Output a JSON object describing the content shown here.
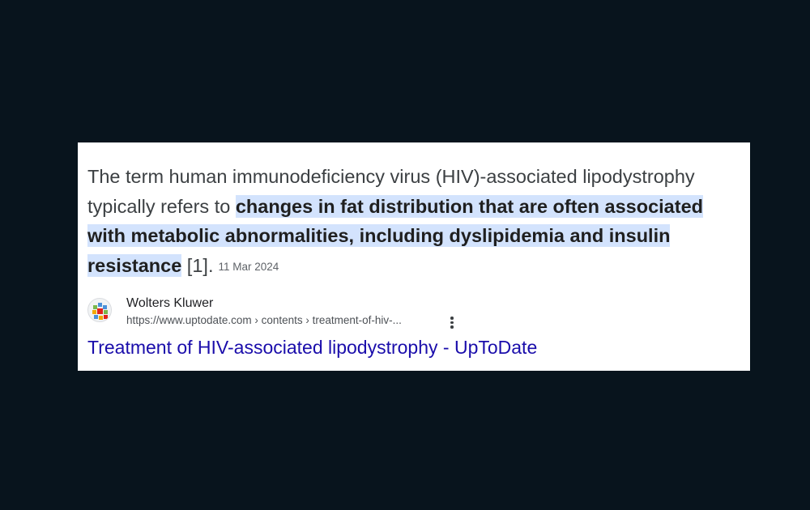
{
  "snippet": {
    "prefix": "The term human immunodeficiency virus (HIV)-associated lipodystrophy typically refers to ",
    "highlight": "changes in fat distribution that are often associated with metabolic abnormalities, including dyslipidemia and insulin resistance",
    "citation": " [1].",
    "date": "11 Mar 2024"
  },
  "result": {
    "site_name": "Wolters Kluwer",
    "url_breadcrumb": "https://www.uptodate.com › contents › treatment-of-hiv-...",
    "favicon_icon": "wolters-kluwer-logo-icon",
    "more_options_icon": "more-vert-icon",
    "title": "Treatment of HIV-associated lipodystrophy - UpToDate"
  },
  "colors": {
    "page_background": "#08141d",
    "card_background": "#ffffff",
    "highlight_background": "#d3e3fd",
    "link_color": "#1a0dab"
  }
}
